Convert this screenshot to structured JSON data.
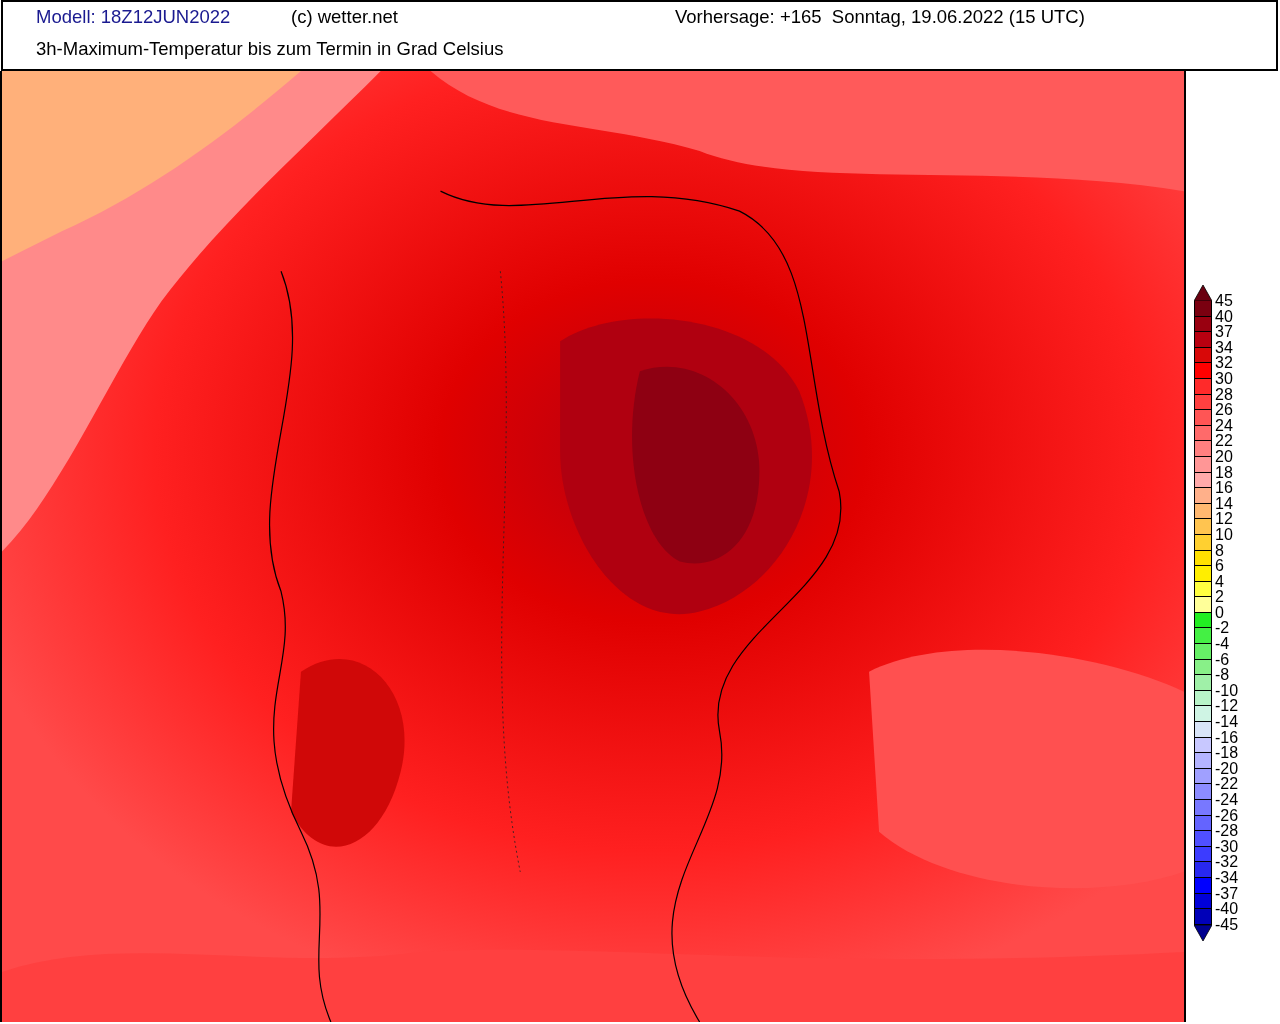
{
  "header": {
    "model": "Modell: 18Z12JUN2022",
    "copyright": "(c) wetter.net",
    "forecast": "Vorhersage: +165  Sonntag, 19.06.2022 (15 UTC)",
    "title": "3h-Maximum-Temperatur bis zum Termin in Grad Celsius"
  },
  "legend": {
    "labels": [
      "45",
      "40",
      "37",
      "34",
      "32",
      "30",
      "28",
      "26",
      "24",
      "22",
      "20",
      "18",
      "16",
      "14",
      "12",
      "10",
      "8",
      "6",
      "4",
      "2",
      "0",
      "-2",
      "-4",
      "-6",
      "-8",
      "-10",
      "-12",
      "-14",
      "-16",
      "-18",
      "-20",
      "-22",
      "-24",
      "-26",
      "-28",
      "-30",
      "-32",
      "-34",
      "-37",
      "-40",
      "-45"
    ],
    "bands": [
      {
        "color": "#6a0010"
      },
      {
        "color": "#7a0010"
      },
      {
        "color": "#990010"
      },
      {
        "color": "#b80010"
      },
      {
        "color": "#d80808"
      },
      {
        "color": "#ff0000"
      },
      {
        "color": "#ff2a2a"
      },
      {
        "color": "#ff4040"
      },
      {
        "color": "#ff5555"
      },
      {
        "color": "#ff6a6a"
      },
      {
        "color": "#ff8080"
      },
      {
        "color": "#ff9696"
      },
      {
        "color": "#ffaaaa"
      },
      {
        "color": "#ffb08a"
      },
      {
        "color": "#ffb870"
      },
      {
        "color": "#ffc450"
      },
      {
        "color": "#ffd030"
      },
      {
        "color": "#ffe000"
      },
      {
        "color": "#ffee00"
      },
      {
        "color": "#ffff40"
      },
      {
        "color": "#ffff99"
      },
      {
        "color": "#22ee22"
      },
      {
        "color": "#44f044"
      },
      {
        "color": "#66f066"
      },
      {
        "color": "#88f088"
      },
      {
        "color": "#a0f0a8"
      },
      {
        "color": "#b8f4c8"
      },
      {
        "color": "#cff4e4"
      },
      {
        "color": "#d8e4f8"
      },
      {
        "color": "#c8c8ff"
      },
      {
        "color": "#b4b4ff"
      },
      {
        "color": "#a0a0ff"
      },
      {
        "color": "#8c8cff"
      },
      {
        "color": "#7878ff"
      },
      {
        "color": "#6464ff"
      },
      {
        "color": "#5050ff"
      },
      {
        "color": "#3c3cff"
      },
      {
        "color": "#2828f0"
      },
      {
        "color": "#0000ff"
      },
      {
        "color": "#0000d8"
      },
      {
        "color": "#0000b8"
      },
      {
        "color": "#000090"
      }
    ]
  }
}
